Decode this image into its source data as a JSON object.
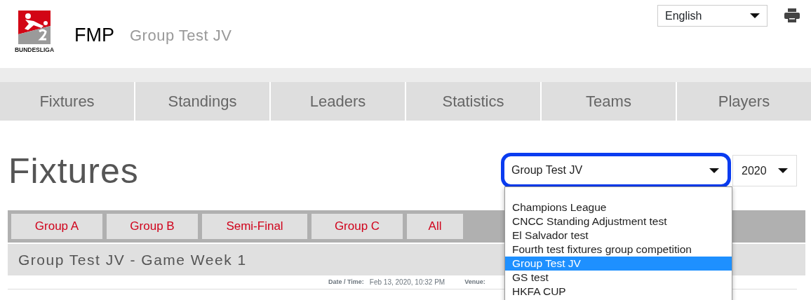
{
  "header": {
    "brand": "FMP",
    "subtitle": "Group Test JV",
    "logo_text": "BUNDESLIGA",
    "language": "English"
  },
  "nav": [
    "Fixtures",
    "Standings",
    "Leaders",
    "Statistics",
    "Teams",
    "Players"
  ],
  "page_title": "Fixtures",
  "competition_select": {
    "value": "Group Test JV",
    "expanded": true,
    "options": [
      {
        "label": "Champions League",
        "selected": false
      },
      {
        "label": "CNCC Standing Adjustment test",
        "selected": false
      },
      {
        "label": "El Salvador test",
        "selected": false
      },
      {
        "label": "Fourth test fixtures group competition",
        "selected": false
      },
      {
        "label": "Group Test JV",
        "selected": true
      },
      {
        "label": "GS test",
        "selected": false
      },
      {
        "label": "HKFA CUP",
        "selected": false
      }
    ]
  },
  "season_select": {
    "value": "2020"
  },
  "group_tabs": [
    "Group A",
    "Group B",
    "Semi-Final",
    "Group C",
    "All"
  ],
  "week_heading": "Group Test JV - Game Week 1",
  "match": {
    "date_label": "Date / Time:",
    "date_value": "Feb 13, 2020, 10:32 PM",
    "venue_label": "Venue:"
  }
}
